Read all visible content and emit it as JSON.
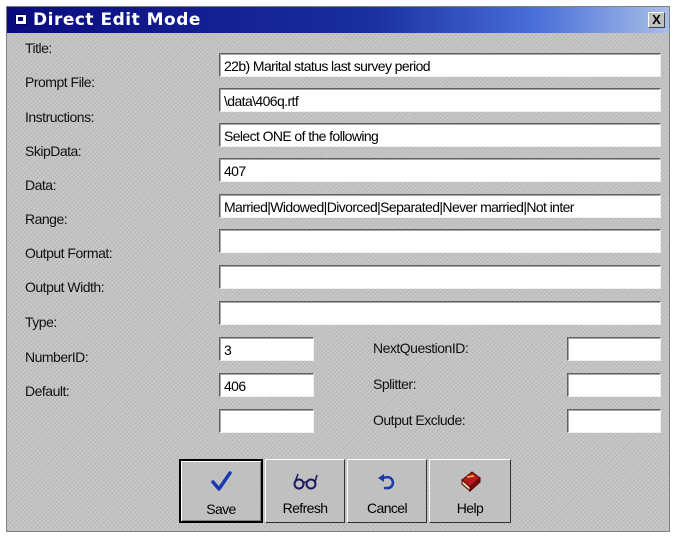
{
  "window": {
    "title": "Direct Edit Mode",
    "close_glyph": "X"
  },
  "fields": {
    "title": {
      "label": "Title:",
      "value": "22b) Marital status last survey period"
    },
    "prompt_file": {
      "label": "Prompt File:",
      "value": "\\data\\406q.rtf"
    },
    "instructions": {
      "label": "Instructions:",
      "value": "Select ONE of the following"
    },
    "skip_data": {
      "label": "SkipData:",
      "value": "407"
    },
    "data": {
      "label": "Data:",
      "value": "Married|Widowed|Divorced|Separated|Never married|Not inter"
    },
    "range": {
      "label": "Range:",
      "value": ""
    },
    "output_format": {
      "label": "Output Format:",
      "value": ""
    },
    "output_width": {
      "label": "Output Width:",
      "value": ""
    },
    "type": {
      "label": "Type:",
      "value": "3"
    },
    "number_id": {
      "label": "NumberID:",
      "value": "406"
    },
    "default": {
      "label": "Default:",
      "value": ""
    },
    "next_question_id": {
      "label": "NextQuestionID:",
      "value": ""
    },
    "splitter": {
      "label": "Splitter:",
      "value": ""
    },
    "output_exclude": {
      "label": "Output Exclude:",
      "value": ""
    }
  },
  "buttons": {
    "save": {
      "label": "Save",
      "icon": "checkmark-icon"
    },
    "refresh": {
      "label": "Refresh",
      "icon": "glasses-icon"
    },
    "cancel": {
      "label": "Cancel",
      "icon": "undo-icon"
    },
    "help": {
      "label": "Help",
      "icon": "help-book-icon"
    }
  },
  "colors": {
    "titlebar": "#0a0a80",
    "accent_blue": "#1a3ab0",
    "help_red": "#b8181e"
  }
}
